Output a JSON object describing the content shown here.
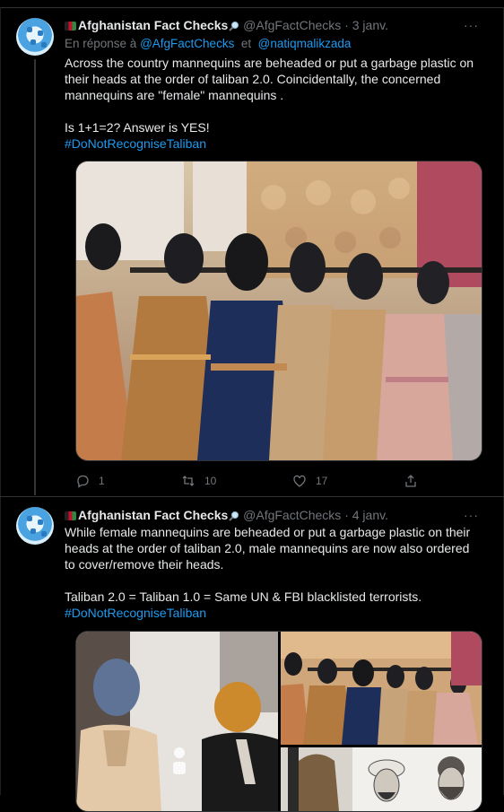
{
  "tweets": [
    {
      "display_name": "Afghanistan Fact Checks",
      "handle": "@AfgFactChecks",
      "separator": "·",
      "date": "3 janv.",
      "reply_prefix": "En réponse à",
      "reply_to_1": "@AfgFactChecks",
      "reply_join": "et",
      "reply_to_2": "@natiqmalikzada",
      "text_1": "Across the country mannequins are beheaded or put a garbage plastic on their heads at the order of taliban 2.0. Coincidentally, the concerned mannequins  are \"female\" mannequins .",
      "text_2": "Is 1+1=2? Answer is YES!",
      "hashtag": "#DoNotRecogniseTaliban",
      "more": "···",
      "reply_count": "1",
      "retweet_count": "10",
      "like_count": "17"
    },
    {
      "display_name": "Afghanistan Fact Checks",
      "handle": "@AfgFactChecks",
      "separator": "·",
      "date": "4 janv.",
      "text_1": "While female mannequins are beheaded or put a garbage plastic on their heads at the order of taliban 2.0, male mannequins are now also ordered to cover/remove their heads.",
      "text_2": "Taliban 2.0 = Taliban 1.0 = Same UN & FBI blacklisted terrorists.",
      "hashtag": "#DoNotRecogniseTaliban",
      "more": "···"
    }
  ],
  "colors": {
    "background": "#000000",
    "text": "#e7e9ea",
    "muted": "#71767b",
    "link": "#1d9bf0",
    "border": "#2f3336"
  },
  "icons": [
    "flag-icon",
    "magnifier-icon",
    "reply-icon",
    "retweet-icon",
    "like-icon",
    "share-icon",
    "more-icon"
  ]
}
